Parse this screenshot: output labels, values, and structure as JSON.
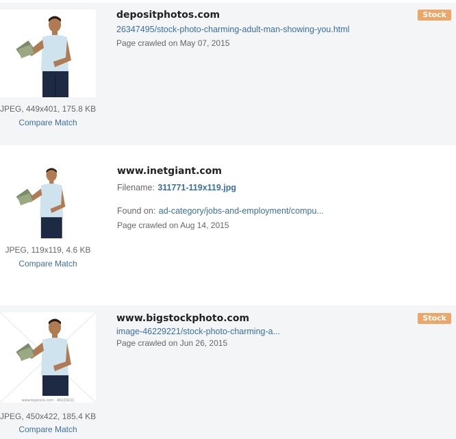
{
  "results": [
    {
      "site": "depositphotos.com",
      "url": "26347495/stock-photo-charming-adult-man-showing-you.html",
      "crawled": "Page crawled on May 07, 2015",
      "image_meta": "JPEG, 449x401, 175.8 KB",
      "compare": "Compare Match",
      "badge": "Stock"
    },
    {
      "site": "www.inetgiant.com",
      "filename_label": "Filename:",
      "filename": "311771-119x119.jpg",
      "found_label": "Found on:",
      "found_url": "ad-category/jobs-and-employment/compu...",
      "crawled": "Page crawled on Aug 14, 2015",
      "image_meta": "JPEG, 119x119, 4.6 KB",
      "compare": "Compare Match"
    },
    {
      "site": "www.bigstockphoto.com",
      "url": "image-46229221/stock-photo-charming-a...",
      "crawled": "Page crawled on Jun 26, 2015",
      "image_meta": "JPEG, 450x422, 185.4 KB",
      "compare": "Compare Match",
      "badge": "Stock",
      "watermark": "www.bigstock.com · 46229221"
    }
  ],
  "colors": {
    "badge": "#eba66a",
    "link": "#3a6ea5",
    "shaded_row": "#f3f5f7"
  }
}
